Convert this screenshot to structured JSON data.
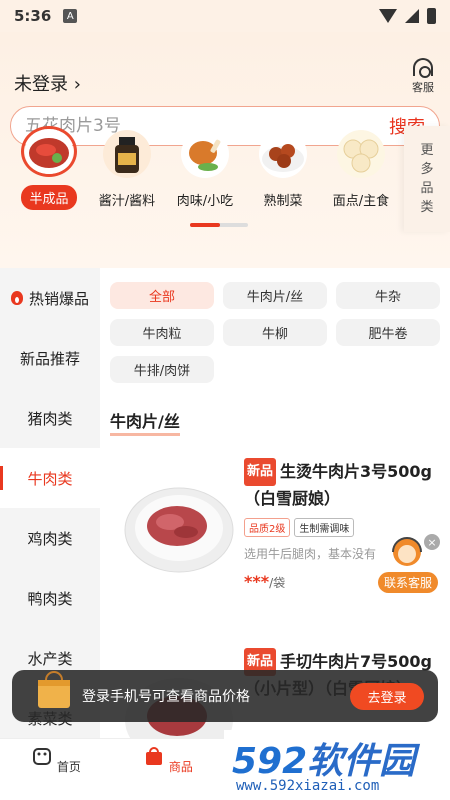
{
  "status_bar": {
    "time": "5:36",
    "notif_icon": "A"
  },
  "header": {
    "login_label": "未登录 ›",
    "service_label": "客服"
  },
  "search": {
    "placeholder": "五花肉片3号",
    "button": "搜索"
  },
  "categories": [
    {
      "label": "半成品",
      "active": true
    },
    {
      "label": "酱汁/酱料"
    },
    {
      "label": "肉味/小吃"
    },
    {
      "label": "熟制菜"
    },
    {
      "label": "面点/主食"
    }
  ],
  "more_categories": [
    "更",
    "多",
    "品",
    "类"
  ],
  "sidebar": [
    {
      "label": "热销爆品",
      "icon": "flame-icon"
    },
    {
      "label": "新品推荐"
    },
    {
      "label": "猪肉类"
    },
    {
      "label": "牛肉类",
      "active": true
    },
    {
      "label": "鸡肉类"
    },
    {
      "label": "鸭肉类"
    },
    {
      "label": "水产类"
    },
    {
      "label": "素菜类"
    }
  ],
  "chips": [
    {
      "label": "全部",
      "active": true
    },
    {
      "label": "牛肉片/丝"
    },
    {
      "label": "牛杂"
    },
    {
      "label": "牛肉粒"
    },
    {
      "label": "牛柳"
    },
    {
      "label": "肥牛卷"
    },
    {
      "label": "牛排/肉饼"
    }
  ],
  "section_title": "牛肉片/丝",
  "products": [
    {
      "badge": "新品",
      "name": "生烫牛肉片3号500g（白雪厨娘）",
      "tags": [
        "品质2级",
        "生制需调味"
      ],
      "desc": "选用牛后腿肉，基本没有",
      "price_mask": "***",
      "unit": "/袋"
    },
    {
      "badge": "新品",
      "name": "手切牛肉片7号500g（小片型）（白雪厨娘）"
    }
  ],
  "float_service": {
    "label": "联系客服",
    "close": "×"
  },
  "login_toast": {
    "message": "登录手机号可查看商品价格",
    "button": "去登录"
  },
  "tabbar": [
    {
      "label": "首页"
    },
    {
      "label": "商品",
      "active": true
    }
  ],
  "watermark": {
    "brand_num": "592",
    "brand_text": "软件园",
    "url": "www.592xiazai.com"
  },
  "colors": {
    "accent": "#e9381f",
    "header_bg": "#fdf0e4",
    "service_orange": "#f08a2b"
  }
}
